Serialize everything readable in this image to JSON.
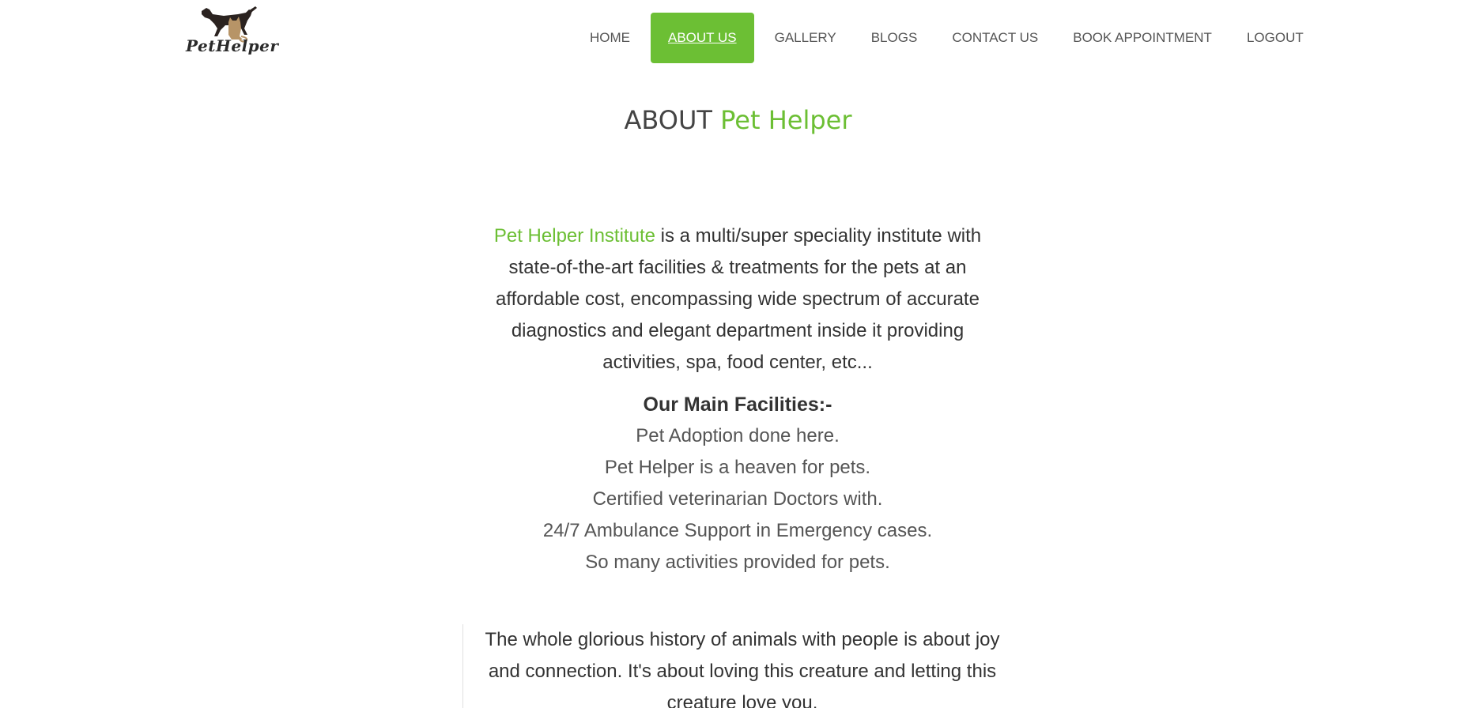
{
  "brand": {
    "name": "PetHelper"
  },
  "nav": {
    "items": [
      {
        "label": "HOME"
      },
      {
        "label": "ABOUT US"
      },
      {
        "label": "GALLERY"
      },
      {
        "label": "BLOGS"
      },
      {
        "label": "CONTACT US"
      },
      {
        "label": "BOOK APPOINTMENT"
      },
      {
        "label": "LOGOUT"
      }
    ],
    "active": "ABOUT US"
  },
  "about": {
    "title_prefix": "ABOUT",
    "title_accent": "Pet Helper",
    "intro_accent": "Pet Helper Institute",
    "intro_text": " is a multi/super speciality institute with state-of-the-art facilities & treatments for the pets at an affordable cost, encompassing wide spectrum of accurate diagnostics and elegant department inside it providing activities, spa, food center, etc...",
    "facilities_heading": "Our Main Facilities:-",
    "facilities": [
      "Pet Adoption done here.",
      "Pet Helper is a heaven for pets.",
      "Certified veterinarian Doctors with.",
      "24/7 Ambulance Support in Emergency cases.",
      "So many activities provided for pets."
    ],
    "quote": "The whole glorious history of animals with people is about joy and connection. It's about loving this creature and letting this creature love you."
  },
  "colors": {
    "accent": "#6cbf34",
    "text": "#333333",
    "nav_text": "#555555"
  }
}
